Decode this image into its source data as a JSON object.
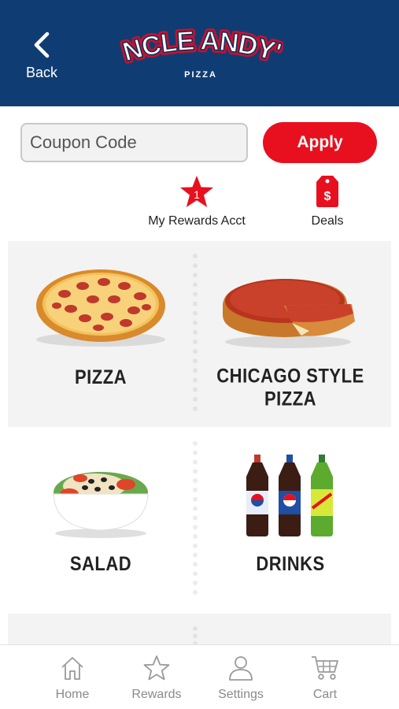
{
  "header": {
    "back_label": "Back",
    "logo": {
      "line1": "UNCLE ANDY'S",
      "line2": "PIZZA"
    },
    "background": "#0f3d73"
  },
  "coupon": {
    "placeholder": "Coupon Code",
    "value": "",
    "apply_label": "Apply",
    "apply_color": "#e8101e"
  },
  "quick_links": {
    "rewards": {
      "label": "My Rewards Acct",
      "badge": "1",
      "icon": "star-badge-icon"
    },
    "deals": {
      "label": "Deals",
      "icon": "price-tag-icon"
    }
  },
  "menu": {
    "pizza": {
      "label": "PIZZA",
      "icon": "pepperoni-pizza-image"
    },
    "chicago": {
      "label": "CHICAGO STYLE PIZZA",
      "icon": "deep-dish-pizza-image"
    },
    "salad": {
      "label": "SALAD",
      "icon": "salad-bowl-image"
    },
    "drinks": {
      "label": "DRINKS",
      "icon": "soda-bottles-image"
    }
  },
  "tabbar": {
    "home": {
      "label": "Home",
      "icon": "house-icon"
    },
    "rewards": {
      "label": "Rewards",
      "icon": "star-outline-icon"
    },
    "settings": {
      "label": "Settings",
      "icon": "person-icon"
    },
    "cart": {
      "label": "Cart",
      "icon": "cart-icon"
    }
  }
}
